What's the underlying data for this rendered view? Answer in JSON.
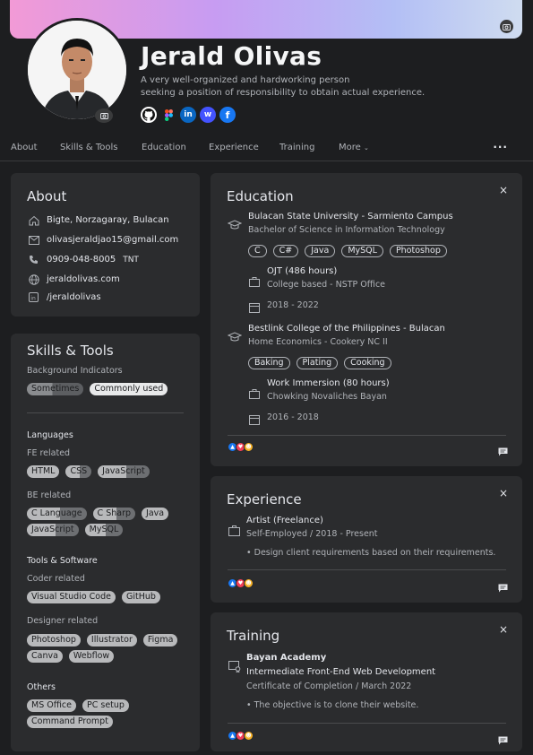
{
  "profile": {
    "name": "Jerald Olivas",
    "tagline_line1": "A very well-organized and hardworking person",
    "tagline_line2": "seeking a position of responsibility to obtain actual experience.",
    "socials": [
      {
        "name": "github-icon",
        "color": "#ffffff"
      },
      {
        "name": "figma-icon",
        "color": "#1d1e20"
      },
      {
        "name": "linkedin-icon",
        "color": "#0a66c2"
      },
      {
        "name": "webflow-icon",
        "color": "#4353ff"
      },
      {
        "name": "facebook-icon",
        "color": "#1877f2"
      }
    ]
  },
  "nav": {
    "items": [
      "About",
      "Skills & Tools",
      "Education",
      "Experience",
      "Training"
    ],
    "more": "More",
    "ellipsis": "..."
  },
  "about": {
    "title": "About",
    "address": "Bigte, Norzagaray, Bulacan",
    "email": "olivasjeraldjao15@gmail.com",
    "phone": "0909-048-8005",
    "phone_carrier": "TNT",
    "website": "jeraldolivas.com",
    "linkedin": "/jeraldolivas"
  },
  "skills": {
    "title": "Skills & Tools",
    "background_label": "Background Indicators",
    "indicators": [
      "Sometimes",
      "Commonly used"
    ],
    "languages_label": "Languages",
    "fe_label": "FE related",
    "fe": [
      "HTML",
      "CSS",
      "JavaScript"
    ],
    "be_label": "BE related",
    "be": [
      "C Language",
      "C Sharp",
      "Java",
      "JavaScript",
      "MySQL"
    ],
    "tools_label": "Tools & Software",
    "coder_label": "Coder related",
    "coder": [
      "Visual Studio Code",
      "GitHub"
    ],
    "designer_label": "Designer related",
    "designer": [
      "Photoshop",
      "Illustrator",
      "Figma",
      "Canva",
      "Webflow"
    ],
    "others_label": "Others",
    "others": [
      "MS Office",
      "PC setup",
      "Command Prompt"
    ]
  },
  "education": {
    "title": "Education",
    "close": "×",
    "schools": [
      {
        "name": "Bulacan State University - Sarmiento Campus",
        "degree": "Bachelor of Science in Information Technology",
        "tags": [
          "C",
          "C#",
          "Java",
          "MySQL",
          "Photoshop"
        ],
        "work_title": "OJT (486 hours)",
        "work_place": "College based - NSTP Office",
        "years": "2018 - 2022"
      },
      {
        "name": "Bestlink College of the Philippines - Bulacan",
        "degree": "Home Economics - Cookery NC II",
        "tags": [
          "Baking",
          "Plating",
          "Cooking"
        ],
        "work_title": "Work Immersion (80 hours)",
        "work_place": "Chowking Novaliches Bayan",
        "years": "2016 - 2018"
      }
    ]
  },
  "experience": {
    "title": "Experience",
    "close": "×",
    "role": "Artist (Freelance)",
    "detail": "Self-Employed / 2018 - Present",
    "bullet": "Design client requirements based on their requirements."
  },
  "training": {
    "title": "Training",
    "close": "×",
    "org": "Bayan Academy",
    "course": "Intermediate Front-End Web Development",
    "detail": "Certificate of Completion / March 2022",
    "bullet": "The objective is to clone their website."
  },
  "colors": {
    "like": "#1877f2",
    "love": "#f33e58",
    "haha": "#f7b125"
  }
}
